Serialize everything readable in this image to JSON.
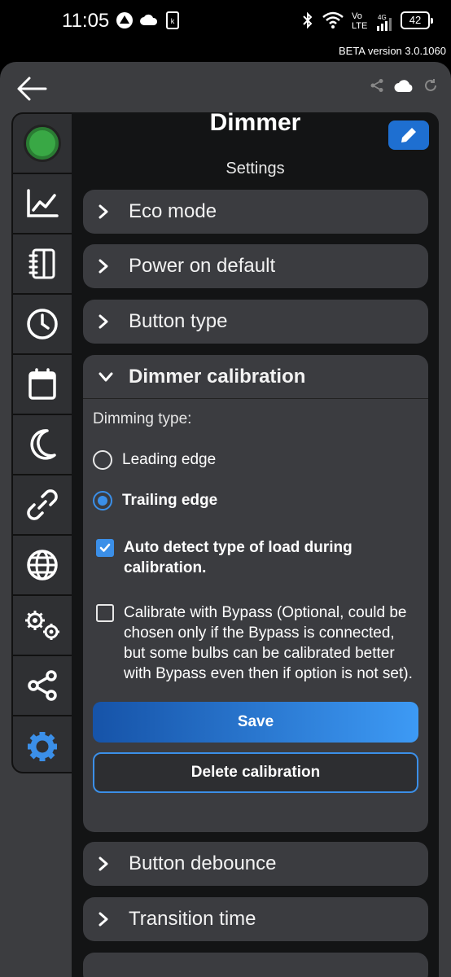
{
  "status_bar": {
    "time": "11:05",
    "network": "Vo LTE",
    "signal_gen": "4G",
    "battery": "42"
  },
  "beta_label": "BETA version 3.0.1060",
  "device": {
    "title": "Dimmer",
    "subtitle": "Settings"
  },
  "sidebar": {
    "items": [
      {
        "name": "device-avatar"
      },
      {
        "icon": "chart-icon"
      },
      {
        "icon": "notebook-icon"
      },
      {
        "icon": "clock-icon"
      },
      {
        "icon": "calendar-icon"
      },
      {
        "icon": "moon-icon"
      },
      {
        "icon": "link-icon"
      },
      {
        "icon": "globe-icon"
      },
      {
        "icon": "gears-icon"
      },
      {
        "icon": "share-icon"
      },
      {
        "icon": "gear-icon",
        "active": true
      }
    ]
  },
  "sections": {
    "eco_mode": "Eco mode",
    "power_on_default": "Power on default",
    "button_type": "Button type",
    "dimmer_calibration": "Dimmer calibration",
    "button_debounce": "Button debounce",
    "transition_time": "Transition time"
  },
  "calibration": {
    "dimming_type_label": "Dimming type:",
    "leading_edge": "Leading edge",
    "trailing_edge": "Trailing edge",
    "selected": "trailing_edge",
    "auto_detect": "Auto detect type of load during calibration.",
    "auto_detect_checked": true,
    "bypass": "Calibrate with Bypass (Optional, could be chosen only if the Bypass is connected, but some bulbs can be calibrated better with Bypass even then if option is not set).",
    "bypass_checked": false,
    "save": "Save",
    "delete": "Delete calibration"
  },
  "colors": {
    "accent": "#3b8fe8",
    "panel": "#131415",
    "card": "#3b3c40",
    "sidebar": "#2f3033"
  }
}
